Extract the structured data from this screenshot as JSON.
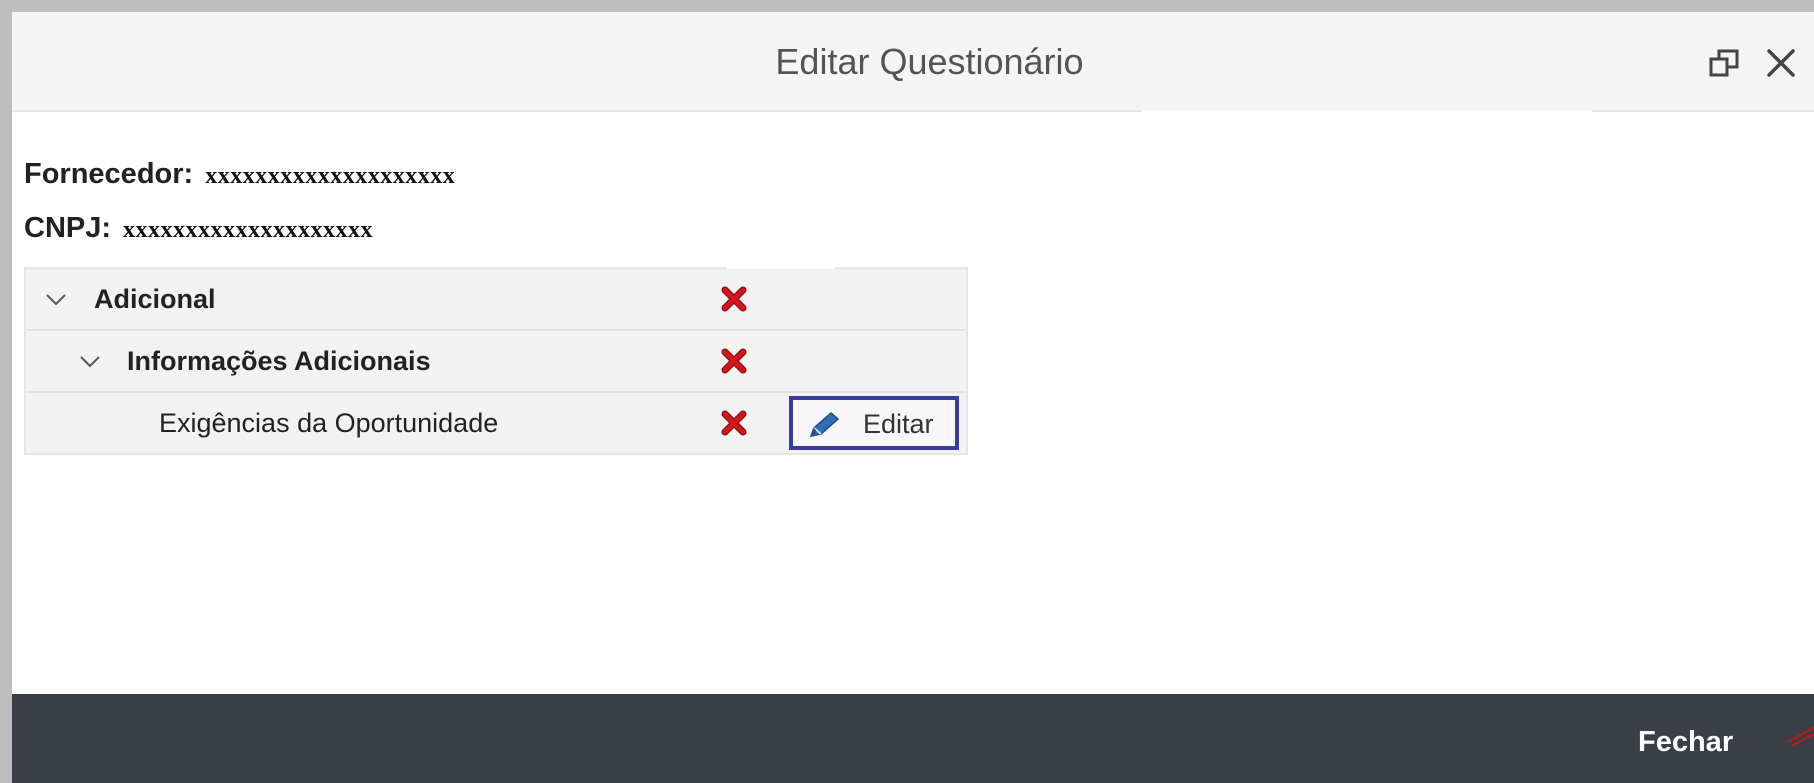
{
  "dialog": {
    "title": "Editar Questionário",
    "maximize_icon": "restore-window-icon",
    "close_icon": "close-icon"
  },
  "supplier": {
    "label": "Fornecedor:",
    "value": "xxxxxxxxxxxxxxxxxxxx"
  },
  "cnpj": {
    "label": "CNPJ:",
    "value": "xxxxxxxxxxxxxxxxxxxx"
  },
  "tree": {
    "rows": [
      {
        "label": "Adicional",
        "expanded": true,
        "status_icon": "red-x-icon"
      },
      {
        "label": "Informações Adicionais",
        "expanded": true,
        "status_icon": "red-x-icon"
      },
      {
        "label": "Exigências da Oportunidade",
        "status_icon": "red-x-icon",
        "action_label": "Editar",
        "action_icon": "pencil-icon"
      }
    ]
  },
  "footer": {
    "close_label": "Fechar"
  },
  "colors": {
    "footer_bg": "#3a3f45",
    "highlight_border": "#3b3ba0",
    "status_red": "#d4161c",
    "pencil_blue": "#2f6db5"
  }
}
